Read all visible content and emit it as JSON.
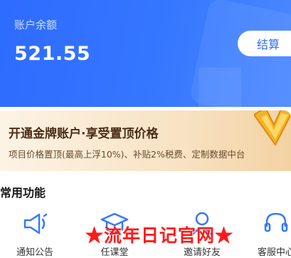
{
  "balance": {
    "label": "账户余额",
    "amount": "521.55",
    "settle_button": "结算"
  },
  "gold_banner": {
    "title": "开通金牌账户·享受置顶价格",
    "description": "项目价格置顶(最高上浮10%)、补贴2%税费、定制数据中台",
    "icon": "crown-v-icon"
  },
  "functions": {
    "title": "常用功能",
    "items": [
      {
        "label": "通知公告",
        "icon": "megaphone-icon"
      },
      {
        "label": "任课堂",
        "icon": "graduation-cap-icon"
      },
      {
        "label": "邀请好友",
        "icon": "user-icon"
      },
      {
        "label": "客服中心",
        "icon": "headset-icon"
      }
    ]
  },
  "watermark": "★流年日记官网★",
  "colors": {
    "primary_blue": "#2e6bff",
    "gold_text": "#4a2d17",
    "watermark_red": "#ff1a1a"
  }
}
